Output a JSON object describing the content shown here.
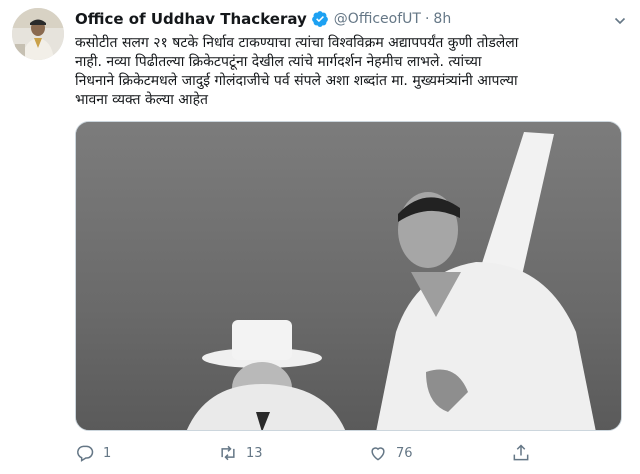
{
  "tweet": {
    "author_name": "Office of Uddhav Thackeray",
    "handle": "@OfficeofUT",
    "separator": "·",
    "time": "8h",
    "text_lines": [
      "कसोटीत सलग २१ षटके निर्धाव टाकण्याचा त्यांचा विश्वविक्रम अद्यापपर्यंत कुणी तोडलेला",
      "नाही. नव्या पिढीतल्या क्रिकेटपटूंना देखील त्यांचे मार्गदर्शन नेहमीच लाभले. त्यांच्या",
      "निधनाने क्रिकेटमधले जादुई गोलंदाजीचे पर्व संपले अशा शब्दांत मा. मुख्यमंत्र्यांनी आपल्या",
      "भावना व्यक्त केल्या आहेत"
    ],
    "actions": {
      "reply_count": "1",
      "retweet_count": "13",
      "like_count": "76"
    }
  },
  "icons": {
    "verified": "verified-badge-icon",
    "more": "chevron-down-icon",
    "reply": "reply-icon",
    "retweet": "retweet-icon",
    "like": "heart-icon",
    "share": "share-icon"
  },
  "colors": {
    "verified_blue": "#1da1f2",
    "secondary_text": "#657786"
  }
}
